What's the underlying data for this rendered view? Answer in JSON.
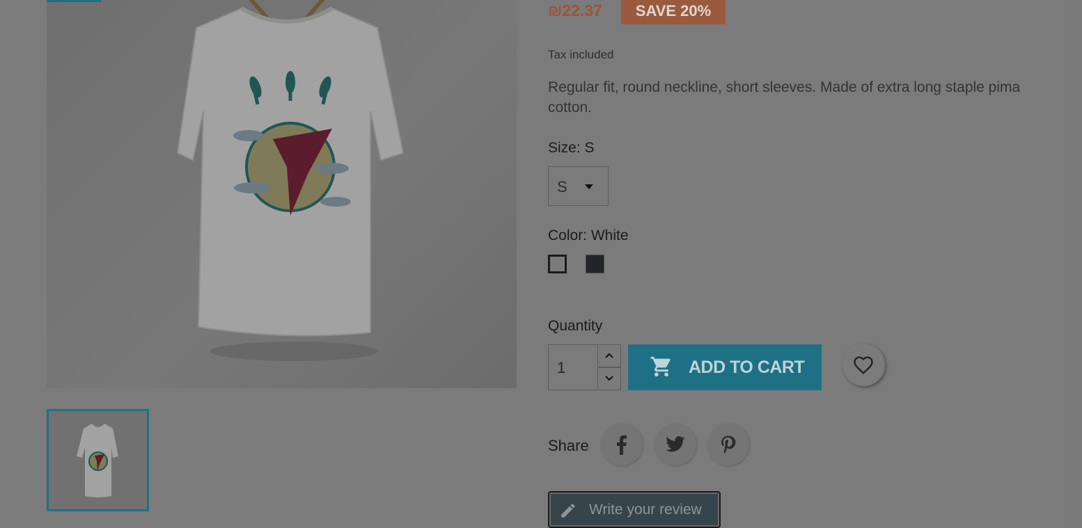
{
  "product": {
    "price": "₪22.37",
    "discount_label": "SAVE 20%",
    "tax_note": "Tax included",
    "description": "Regular fit, round neckline, short sleeves. Made of extra long staple pima cotton.",
    "size_label": "Size: S",
    "size_value": "S",
    "color_label": "Color: White",
    "quantity_label": "Quantity",
    "quantity_value": "1",
    "add_to_cart_label": "ADD TO CART",
    "share_label": "Share",
    "review_label": "Write your review"
  },
  "colors": {
    "accent": "#1e7184",
    "discount_bg": "#9a5a3e",
    "swatch_black": "#222427"
  },
  "icons": [
    "cart-icon",
    "heart-icon",
    "facebook-icon",
    "twitter-icon",
    "pinterest-icon",
    "pencil-icon",
    "chevron-up-icon",
    "chevron-down-icon",
    "caret-down-icon"
  ]
}
